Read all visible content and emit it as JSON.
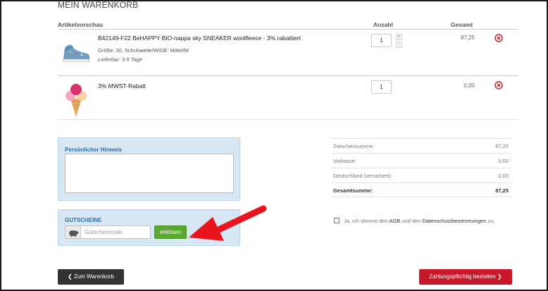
{
  "page": {
    "title": "MEIN WARENKORB"
  },
  "cart": {
    "headers": {
      "article": "Artikelvorschau",
      "quantity": "Anzahl",
      "total": "Gesamt"
    },
    "items": [
      {
        "name": "B42149-F22 BeHAPPY BIO-nappa sky SNEAKER woolfleece - 3% rabattiert",
        "size": "Größe: 30, Schuhweite/WIDE: Mittel/M",
        "delivery": "Lieferbar: 3-5 Tage",
        "quantity": "1",
        "stepper_plus": "+",
        "stepper_minus": "-",
        "price": "87,25",
        "thumb_icon": "sneaker-icon"
      },
      {
        "name": "3% MWST-Rabatt",
        "quantity": "1",
        "price": "0,00",
        "thumb_icon": "ice-cream-icon"
      }
    ]
  },
  "note": {
    "label": "Persönlicher Hinweis",
    "value": ""
  },
  "voucher": {
    "label": "GUTSCHEINE",
    "placeholder": "Gutscheincode",
    "redeem_label": "einlösen",
    "addon_icon": "piggy-bank-icon"
  },
  "totals": {
    "rows": [
      {
        "label": "Zwischensumme:",
        "value": "87,25"
      },
      {
        "label": "Vorkasse:",
        "value": "0,00"
      },
      {
        "label": "Deutschland (versichert):",
        "value": "0,00"
      },
      {
        "label": "Gesamtsumme:",
        "value": "87,25"
      }
    ]
  },
  "terms": {
    "prefix": "Ja, ich stimme den",
    "agb": "AGB",
    "middle": "und den",
    "privacy": "Datenschutzbestimmungen",
    "suffix": "zu."
  },
  "buttons": {
    "back_label": "Zum Warenkorb",
    "back_icon": "chevron-left-icon",
    "order_label": "Zahlungspflichtig bestellen",
    "order_icon": "chevron-right-icon"
  },
  "colors": {
    "accent_green": "#5ba82f",
    "order_red": "#c8192a",
    "panel_blue": "#d7e8f4",
    "remove_red": "#c8192a",
    "annotation_arrow": "#e8141e"
  }
}
